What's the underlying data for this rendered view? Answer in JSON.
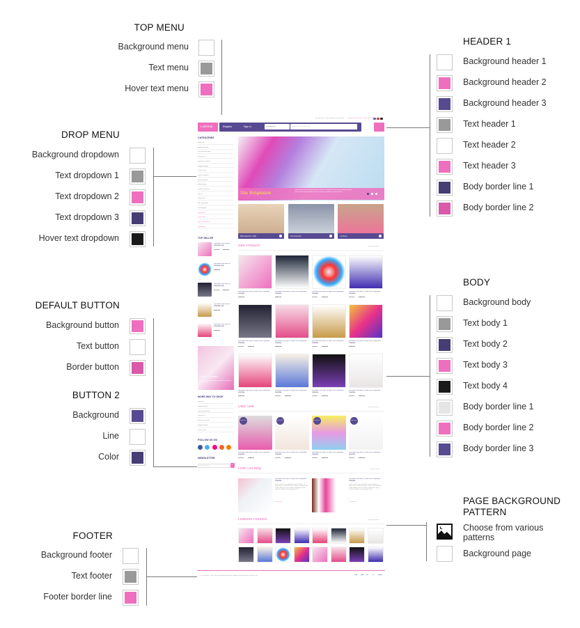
{
  "colors": {
    "white": "#ffffff",
    "gray": "#999999",
    "pink": "#ee6fbe",
    "purple": "#574a91",
    "dark_purple": "#463d75",
    "pink2": "#d85aa8",
    "black": "#1a1a1a",
    "light_gray": "#e5e5e5"
  },
  "top_menu": {
    "title": "TOP MENU",
    "items": [
      {
        "label": "Background menu",
        "color": "#ffffff"
      },
      {
        "label": "Text menu",
        "color": "#999999"
      },
      {
        "label": "Hover text menu",
        "color": "#ee6fbe"
      }
    ]
  },
  "drop_menu": {
    "title": "DROP MENU",
    "items": [
      {
        "label": "Background dropdown",
        "color": "#ffffff"
      },
      {
        "label": "Text dropdown 1",
        "color": "#999999"
      },
      {
        "label": "Text dropdown 2",
        "color": "#ee6fbe"
      },
      {
        "label": "Text dropdown 3",
        "color": "#463d75"
      },
      {
        "label": "Hover text dropdown",
        "color": "#1a1a1a"
      }
    ]
  },
  "default_button": {
    "title": "DEFAULT BUTTON",
    "items": [
      {
        "label": "Background button",
        "color": "#ee6fbe"
      },
      {
        "label": "Text button",
        "color": "#ffffff"
      },
      {
        "label": "Border button",
        "color": "#d85aa8"
      }
    ]
  },
  "button2": {
    "title": "BUTTON 2",
    "items": [
      {
        "label": "Background",
        "color": "#574a91"
      },
      {
        "label": "Line",
        "color": "#ffffff"
      },
      {
        "label": "Color",
        "color": "#463d75"
      }
    ]
  },
  "footer": {
    "title": "FOOTER",
    "items": [
      {
        "label": "Background footer",
        "color": "#ffffff"
      },
      {
        "label": "Text footer",
        "color": "#999999"
      },
      {
        "label": "Footer border line",
        "color": "#ee6fbe"
      }
    ]
  },
  "header1": {
    "title": "HEADER 1",
    "items": [
      {
        "label": "Background header 1",
        "color": "#ffffff"
      },
      {
        "label": "Background header 2",
        "color": "#ee6fbe"
      },
      {
        "label": "Background header 3",
        "color": "#574a91"
      },
      {
        "label": "Text header 1",
        "color": "#999999"
      },
      {
        "label": "Text header 2",
        "color": "#ffffff"
      },
      {
        "label": "Text header 3",
        "color": "#ee6fbe"
      },
      {
        "label": "Body border line 1",
        "color": "#463d75"
      },
      {
        "label": "Body border line 2",
        "color": "#d85aa8"
      }
    ]
  },
  "body": {
    "title": "BODY",
    "items": [
      {
        "label": "Background body",
        "color": "#ffffff"
      },
      {
        "label": "Text body 1",
        "color": "#999999"
      },
      {
        "label": "Text body 2",
        "color": "#463d75"
      },
      {
        "label": "Text body 3",
        "color": "#ee6fbe"
      },
      {
        "label": "Text body 4",
        "color": "#1a1a1a"
      },
      {
        "label": "Body border line 1",
        "color": "#e5e5e5"
      },
      {
        "label": "Body border line 2",
        "color": "#ee6fbe"
      },
      {
        "label": "Body border line 3",
        "color": "#574a91"
      }
    ]
  },
  "page_bg": {
    "title_line1": "PAGE BACKGROUND",
    "title_line2": "PATTERN",
    "pattern_label_line1": "Choose from various",
    "pattern_label_line2": "patterns",
    "icon": "image-icon",
    "bg_label": "Background page",
    "bg_color": "#ffffff"
  },
  "preview": {
    "top_links": "My account  |  My wishlist  |  Checkout  |",
    "customer_service": "Customer Service: 1900 123 1000",
    "logo": "Giftshop",
    "register": "Register",
    "sign_in": "Sign In",
    "category_select": "All categories",
    "search_placeholder": "Search entire store here",
    "cart_count": "0",
    "categories_title": "CATEGORIES",
    "categories": [
      "Dolor sit",
      "Adipiscing elit",
      "Sed do eiusmod",
      "Tempor ut",
      "Labore et dolore",
      "Magna aliqua",
      "Ut enim ad",
      "Minim veniam",
      "Quis nostrud",
      "Exercitation",
      "Ullamco laboris",
      "Nisi ut",
      "Aliquip ex",
      "Ea commodo",
      "Consequat",
      "Duis aute",
      "Irure dolor",
      "Reprehenderit in",
      "Voluptate"
    ],
    "banner_title": "Sita Voluptatem",
    "banner_text": "Nemo enim ipsam voluptatem quia voluptas sit aspernatur aut odit aut fugit, sed quia consequuntur magni dolores eos qui ratione voluptatem sequi nesciunt.",
    "tiles": [
      "Handmade Gifts",
      "Accessories",
      "Clothes"
    ],
    "top_seller_title": "TOP SELLER",
    "top_seller": [
      {
        "name": "Duis aute irure dolor in voluptate quis",
        "old": "$129.00",
        "price": "$109.00"
      },
      {
        "name": "Duis aute irure dolor in voluptate quis",
        "old": "",
        "price": "$109.00"
      },
      {
        "name": "Duis aute irure dolor in voluptate quis",
        "old": "$129.00",
        "price": "$109.00"
      },
      {
        "name": "Duis aute irure dolor in voluptate quis",
        "old": "",
        "price": "$109.00"
      },
      {
        "name": "Duis aute irure dolor in voluptate quis",
        "old": "",
        "price": "$109.00"
      }
    ],
    "promo_title": "Nemo Solorem",
    "promo_text": "Neque porro quisquam est, qui dolorem ipsum quia dolor sit amet",
    "new_products_title": "New Products",
    "view_all": "View all products ›",
    "product_name": "Duis aute irure dolor in totam rem et aperiam voluptate",
    "new_products": [
      {
        "old": "",
        "price": "$109.00"
      },
      {
        "old": "",
        "price": "$109.00"
      },
      {
        "old": "$129.00",
        "price": "$109.00"
      },
      {
        "old": "$129.00",
        "price": "$109.00"
      },
      {
        "old": "$129.00",
        "price": "$109.00"
      },
      {
        "old": "",
        "price": "$109.00"
      },
      {
        "old": "$129.00",
        "price": "$109.00"
      },
      {
        "old": "",
        "price": "$109.00"
      },
      {
        "old": "",
        "price": "$109.00"
      },
      {
        "old": "$129.00",
        "price": "$109.00"
      },
      {
        "old": "$129.00",
        "price": "$109.00"
      },
      {
        "old": "$129.00",
        "price": "$109.00"
      }
    ],
    "more_way_title": "MORE WAY TO SHOP",
    "more_way": [
      "Dolor sit",
      "Adipiscing elit",
      "Sed do eiusmod",
      "Tempor ut",
      "Labore et dolore",
      "Magna aliqua",
      "Ut enim ad"
    ],
    "follow_title": "FOLLOW US ON",
    "social": [
      "facebook",
      "twitter",
      "flickr",
      "rss",
      "blogger"
    ],
    "newsletter_title": "NEWSLETTER",
    "newsletter_placeholder": "Enter your email",
    "newsletter_button": "GO",
    "daily_sale_title": "Daily Sale",
    "sale_badge": "Sale 40%",
    "daily_sale": [
      {
        "old": "$129.00",
        "price": "$109.00"
      },
      {
        "old": "$129.00",
        "price": "$109.00"
      },
      {
        "old": "$129.00",
        "price": "$109.00"
      },
      {
        "old": "$129.00",
        "price": "$109.00"
      }
    ],
    "blog_title": "From Our Blog",
    "view_blog": "View our blog ›",
    "blog_post_title": "Duis aute irure dolor in totam rem et aperiam voluptate",
    "blog_post_text": "Nemo enim ipsam voluptatem quia voluptas sit aspernatur aut odit aut fugit, sed quia consequuntur magni dolores eos qui ratione voluptatem sequi nesciunt. Neque porro quisquam est.",
    "read_more": "View more ›",
    "featured_title": "Featured Products",
    "copyright": "© 2015 Giftshop Online Store. All Rights Reserved. Magento design by DaleThemes.com",
    "payments": [
      "VISA",
      "AmEx",
      "MC",
      "MC",
      "PayPal"
    ]
  }
}
